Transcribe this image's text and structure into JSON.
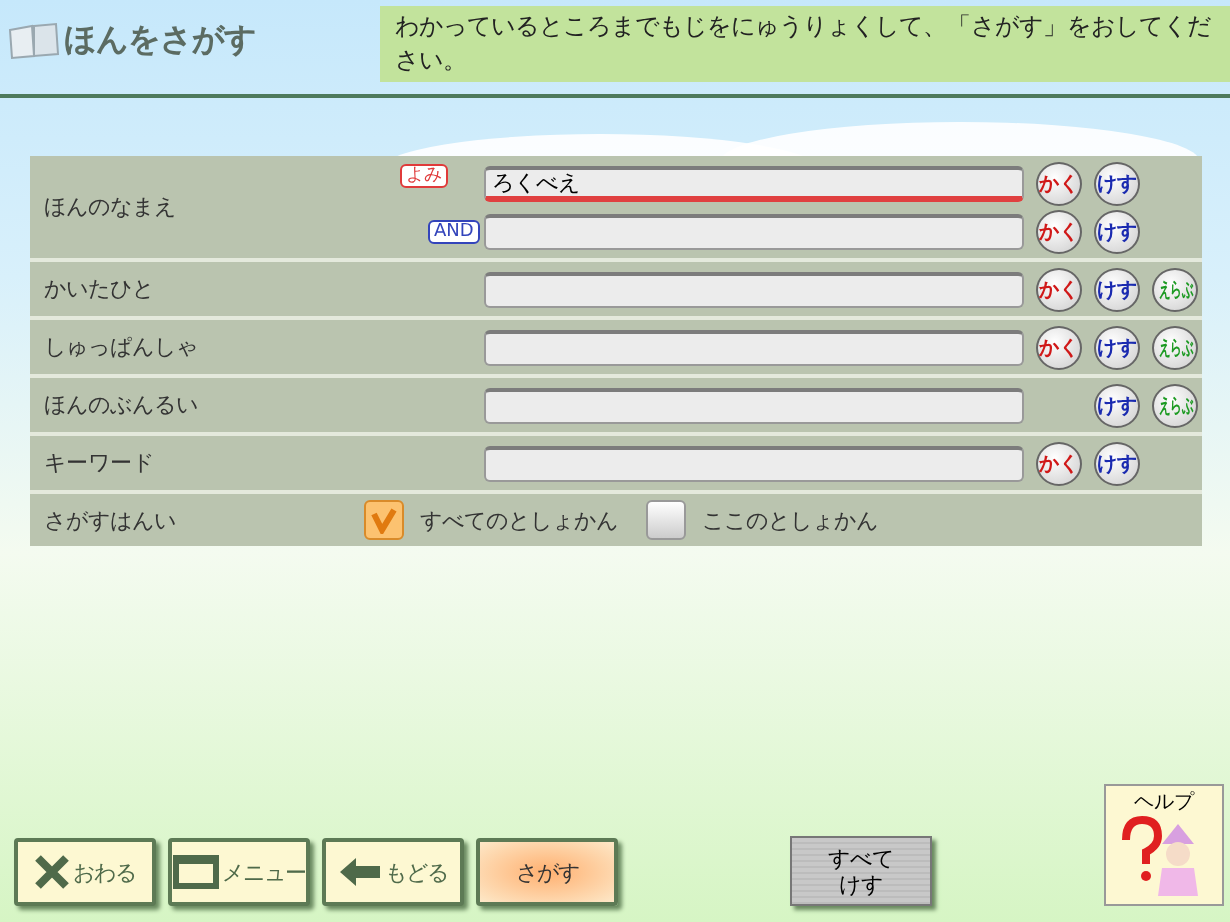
{
  "header": {
    "title": "ほんをさがす",
    "instruction": "わかっているところまでもじをにゅうりょくして、「さがす」をおしてください。"
  },
  "fields": [
    {
      "label": "ほんのなまえ",
      "lines": [
        {
          "tag": {
            "text": "よみ",
            "color": "#e03a3a"
          },
          "value": "ろくべえ",
          "focused": true,
          "buttons": [
            {
              "kind": "kaku",
              "label": "かく"
            },
            {
              "kind": "kesu",
              "label": "けす"
            }
          ]
        },
        {
          "tag": {
            "text": "AND",
            "color": "#3344bb"
          },
          "focused": false,
          "buttons": [
            {
              "kind": "kaku",
              "label": "かく"
            },
            {
              "kind": "kesu",
              "label": "けす"
            }
          ]
        }
      ]
    },
    {
      "label": "かいたひと",
      "lines": [
        {
          "focused": false,
          "buttons": [
            {
              "kind": "kaku",
              "label": "かく"
            },
            {
              "kind": "kesu",
              "label": "けす"
            },
            {
              "kind": "erabu",
              "label": "えらぶ"
            }
          ]
        }
      ]
    },
    {
      "label": "しゅっぱんしゃ",
      "lines": [
        {
          "focused": false,
          "buttons": [
            {
              "kind": "kaku",
              "label": "かく"
            },
            {
              "kind": "kesu",
              "label": "けす"
            },
            {
              "kind": "erabu",
              "label": "えらぶ"
            }
          ]
        }
      ]
    },
    {
      "label": "ほんのぶんるい",
      "lines": [
        {
          "focused": false,
          "buttons": [
            {
              "kind": "kesu",
              "label": "けす"
            },
            {
              "kind": "erabu",
              "label": "えらぶ"
            }
          ]
        }
      ]
    },
    {
      "label": "キーワード",
      "lines": [
        {
          "focused": false,
          "buttons": [
            {
              "kind": "kaku",
              "label": "かく"
            },
            {
              "kind": "kesu",
              "label": "けす"
            }
          ]
        }
      ]
    }
  ],
  "scope": {
    "label": "さがすはんい",
    "options": [
      {
        "label": "すべてのとしょかん",
        "selected": true
      },
      {
        "label": "ここのとしょかん",
        "selected": false
      }
    ]
  },
  "footer": {
    "buttons": [
      {
        "kind": "close",
        "label": "おわる"
      },
      {
        "kind": "menu",
        "label": "メニュー"
      },
      {
        "kind": "back",
        "label": "もどる"
      },
      {
        "kind": "search",
        "label": "さがす"
      }
    ],
    "clear_all": "すべてけす",
    "help": "ヘルプ"
  }
}
